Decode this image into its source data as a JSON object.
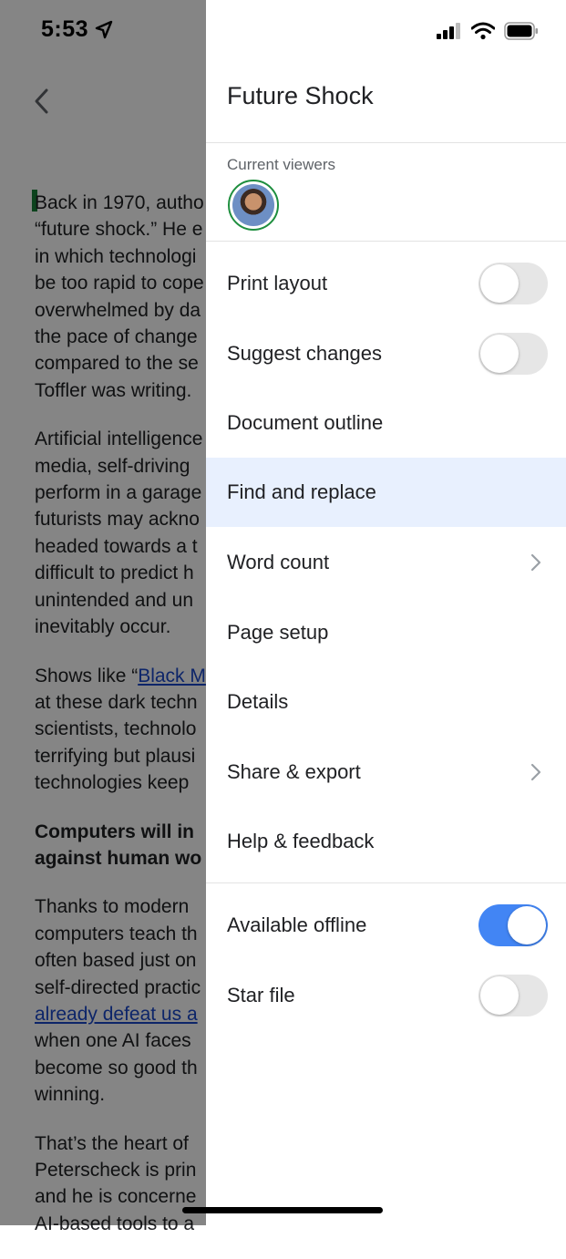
{
  "status_bar": {
    "time": "5:53"
  },
  "document": {
    "paragraphs": [
      {
        "lines": [
          "Back in 1970, autho",
          "“future shock.” He e",
          "in which technologi",
          "be too rapid to cope",
          "overwhelmed by da",
          "the pace of change",
          "compared to the se",
          "Toffler was writing."
        ]
      },
      {
        "lines": [
          "Artificial intelligence",
          "media, self-driving",
          "perform in a garage",
          "futurists may ackno",
          "headed towards a t",
          "difficult to predict h",
          "unintended and un",
          "inevitably occur."
        ]
      },
      {
        "lines_pre": "Shows like “",
        "link": "Black M",
        "lines": [
          "at these dark techn",
          "scientists, technolo",
          "terrifying but plausi",
          "technologies keep"
        ]
      },
      {
        "bold_lines": [
          "Computers will in",
          "against human wo"
        ]
      },
      {
        "lines_top": [
          "Thanks to modern",
          "computers teach th",
          "often based just on",
          "self-directed practic"
        ],
        "link": "already defeat us a",
        "lines": [
          "when one AI faces",
          "become so good th",
          "winning."
        ]
      },
      {
        "lines": [
          "That’s the heart of",
          "Peterscheck is prin",
          "and he is concerne",
          "AI-based tools to a"
        ]
      }
    ]
  },
  "drawer": {
    "title": "Future Shock",
    "viewers_label": "Current viewers",
    "items": [
      {
        "label": "Print layout",
        "control": "toggle",
        "on": false
      },
      {
        "label": "Suggest changes",
        "control": "toggle",
        "on": false
      },
      {
        "label": "Document outline",
        "control": "none"
      },
      {
        "label": "Find and replace",
        "control": "none",
        "highlighted": true
      },
      {
        "label": "Word count",
        "control": "chevron"
      },
      {
        "label": "Page setup",
        "control": "none"
      },
      {
        "label": "Details",
        "control": "none"
      },
      {
        "label": "Share & export",
        "control": "chevron"
      },
      {
        "label": "Help & feedback",
        "control": "none"
      }
    ],
    "secondary_items": [
      {
        "label": "Available offline",
        "control": "toggle",
        "on": true
      },
      {
        "label": "Star file",
        "control": "toggle",
        "on": false
      }
    ]
  },
  "colors": {
    "accent": "#4285f4",
    "highlight": "#e8f0fe",
    "viewer_ring": "#1e8e3e"
  }
}
